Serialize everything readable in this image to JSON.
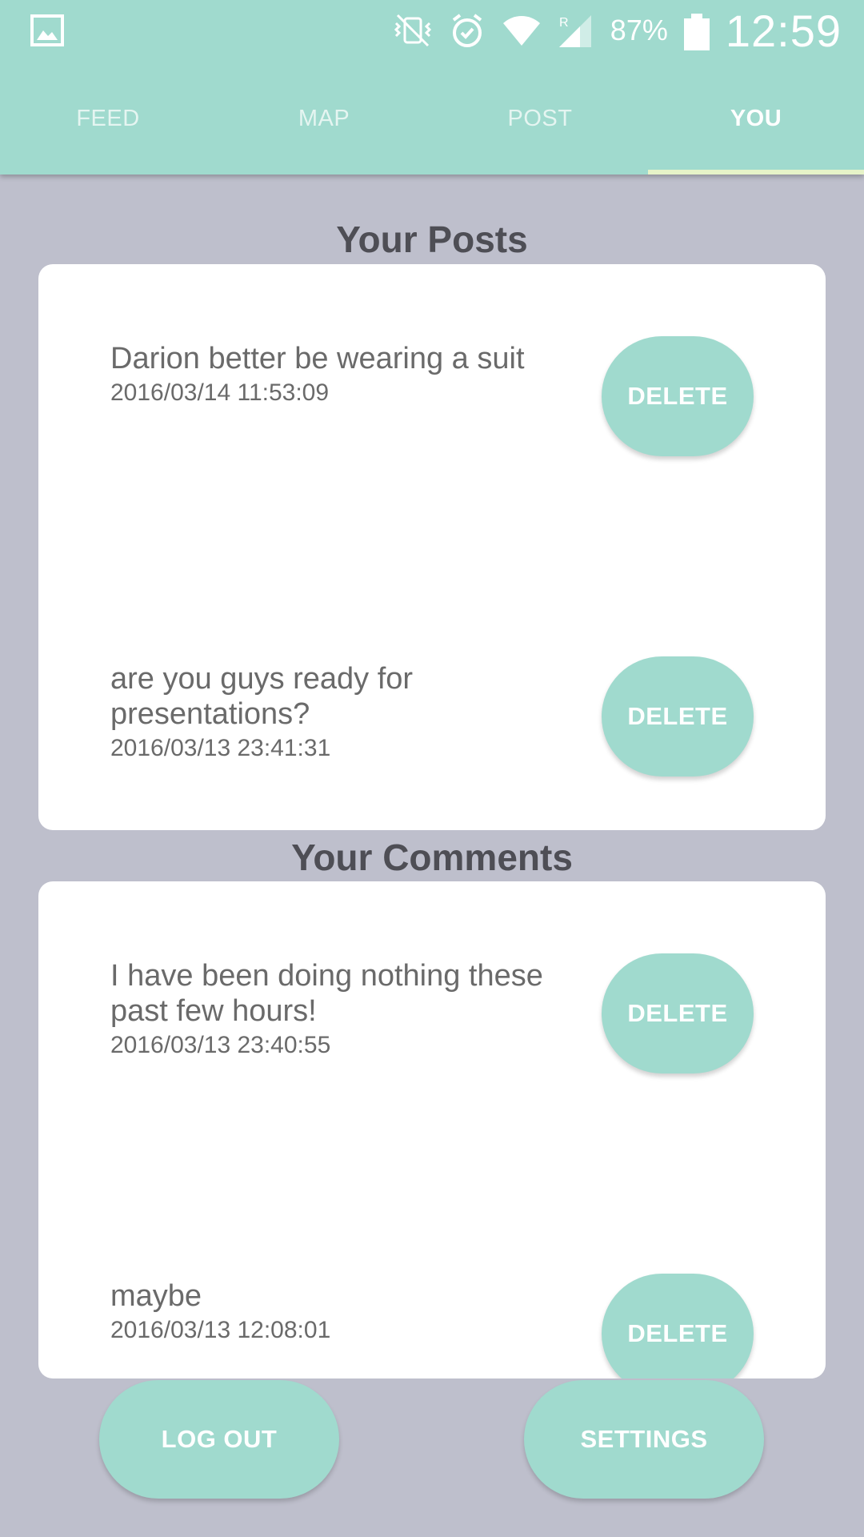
{
  "statusbar": {
    "battery": "87%",
    "time": "12:59",
    "icons": [
      "image-icon",
      "vibrate-icon",
      "alarm-icon",
      "wifi-icon",
      "signal-icon",
      "battery-icon"
    ]
  },
  "tabs": [
    {
      "label": "FEED",
      "active": false
    },
    {
      "label": "MAP",
      "active": false
    },
    {
      "label": "POST",
      "active": false
    },
    {
      "label": "YOU",
      "active": true
    }
  ],
  "posts": {
    "title": "Your Posts",
    "items": [
      {
        "text": "Darion better be wearing a suit",
        "date": "2016/03/14 11:53:09",
        "button": "DELETE"
      },
      {
        "text": "are you guys ready for presentations?",
        "date": "2016/03/13 23:41:31",
        "button": "DELETE"
      }
    ]
  },
  "comments": {
    "title": "Your Comments",
    "items": [
      {
        "text": "I have been doing nothing these past few hours!",
        "date": "2016/03/13 23:40:55",
        "button": "DELETE"
      },
      {
        "text": "maybe",
        "date": "2016/03/13 12:08:01",
        "button": "DELETE"
      }
    ]
  },
  "footer": {
    "logout_label": "LOG OUT",
    "settings_label": "SETTINGS"
  },
  "colors": {
    "accent": "#a0dace",
    "background": "#bebfcc",
    "card": "#ffffff",
    "heading": "#4e4e55",
    "text": "#6a6a6a"
  }
}
